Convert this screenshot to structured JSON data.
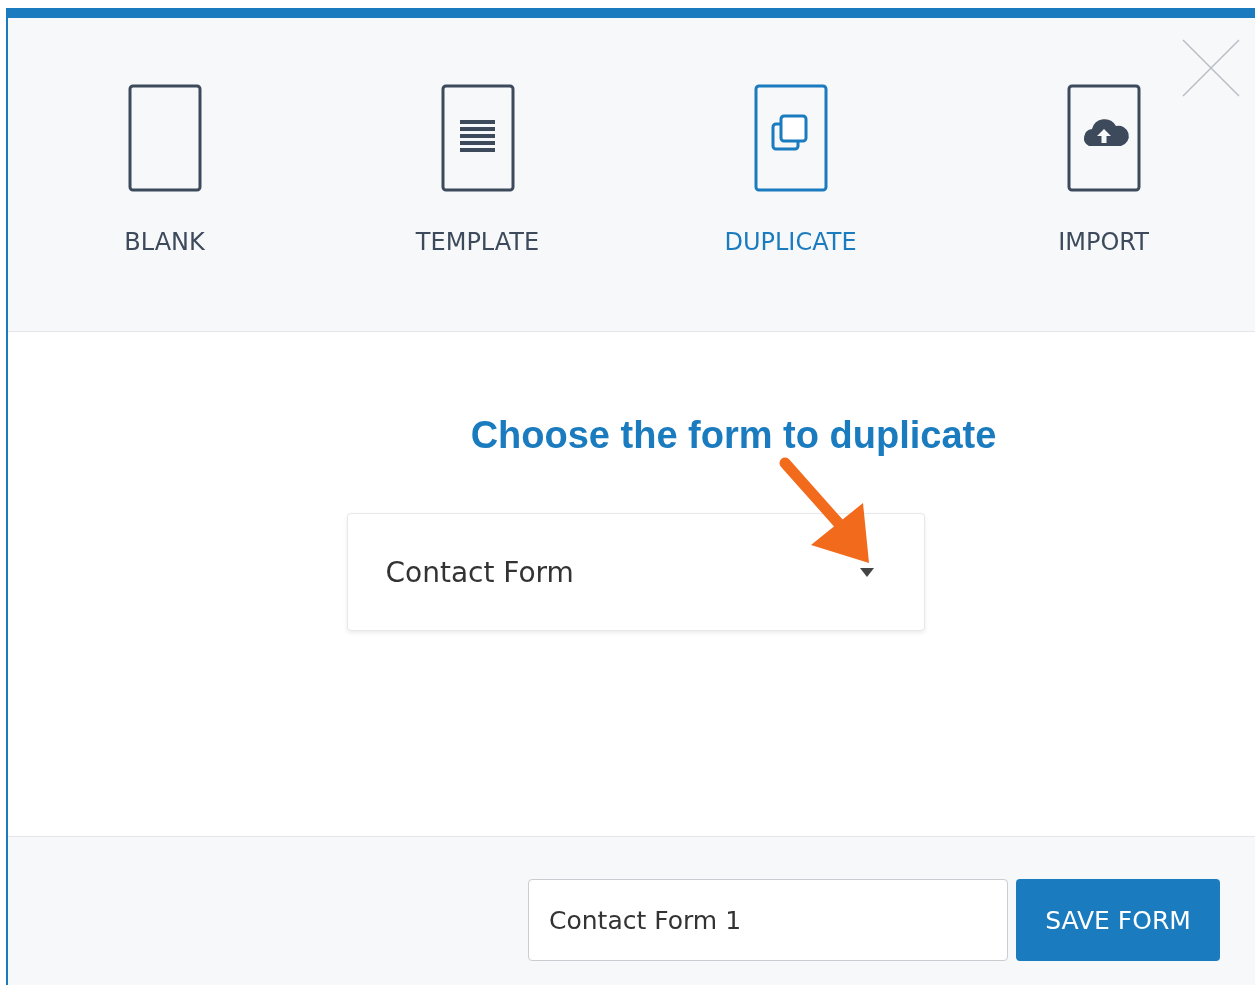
{
  "options": [
    {
      "kind": "blank",
      "label": "BLANK",
      "selected": false
    },
    {
      "kind": "template",
      "label": "TEMPLATE",
      "selected": false
    },
    {
      "kind": "duplicate",
      "label": "DUPLICATE",
      "selected": true
    },
    {
      "kind": "import",
      "label": "IMPORT",
      "selected": false
    }
  ],
  "heading": "Choose the form to duplicate",
  "form_select": {
    "value": "Contact Form"
  },
  "form_name": {
    "value": "Contact Form 1"
  },
  "save_button": "SAVE FORM"
}
